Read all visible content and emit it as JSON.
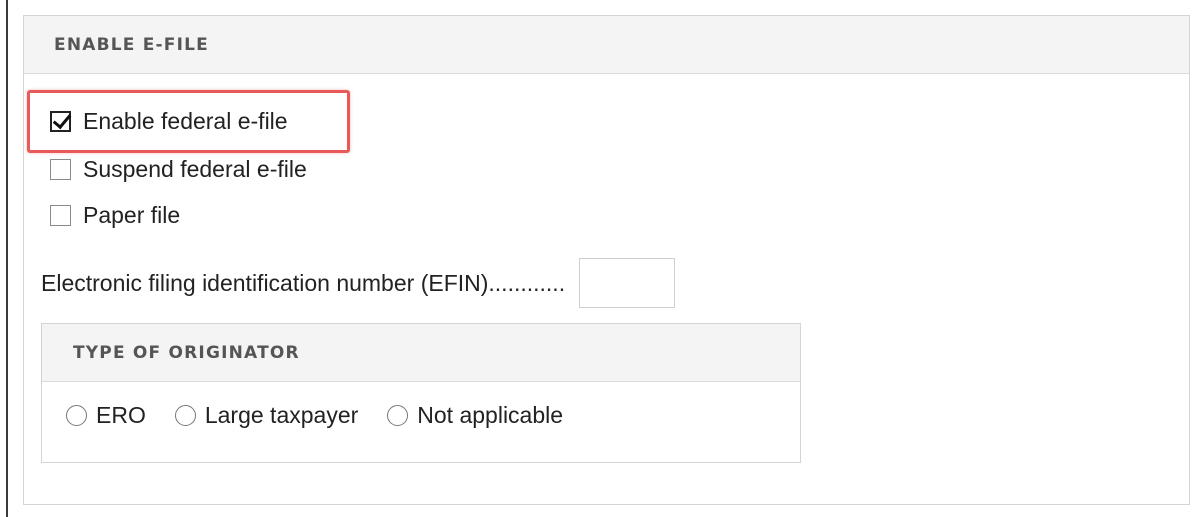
{
  "panel": {
    "title": "ENABLE E-FILE",
    "checkboxes": [
      {
        "label": "Enable federal e-file",
        "checked": true
      },
      {
        "label": "Suspend federal e-file",
        "checked": false
      },
      {
        "label": "Paper file",
        "checked": false
      }
    ],
    "efin": {
      "label": "Electronic filing identification number (EFIN)............",
      "value": ""
    }
  },
  "originator": {
    "title": "TYPE OF ORIGINATOR",
    "options": [
      {
        "label": "ERO",
        "selected": false
      },
      {
        "label": "Large taxpayer",
        "selected": false
      },
      {
        "label": "Not applicable",
        "selected": false
      }
    ]
  },
  "colors": {
    "highlight": "#e85a5a",
    "header_bg": "#f4f4f4",
    "title_text": "#555555"
  }
}
